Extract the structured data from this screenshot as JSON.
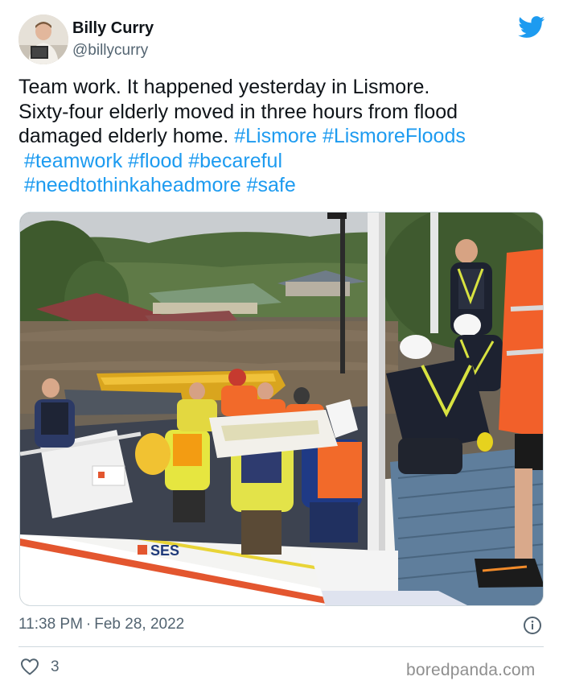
{
  "author": {
    "display_name": "Billy Curry",
    "handle": "@billycurry"
  },
  "tweet": {
    "lines": [
      [
        {
          "text": "Team work. It happened yesterday in Lismore.",
          "tag": false
        }
      ],
      [
        {
          "text": "Sixty-four elderly moved in three hours from flood",
          "tag": false
        }
      ],
      [
        {
          "text": "damaged elderly home. ",
          "tag": false
        },
        {
          "text": "#Lismore",
          "tag": true
        },
        {
          "text": " ",
          "tag": false
        },
        {
          "text": "#LismoreFloods",
          "tag": true
        }
      ],
      [
        {
          "text": " ",
          "tag": false
        },
        {
          "text": "#teamwork",
          "tag": true
        },
        {
          "text": " ",
          "tag": false
        },
        {
          "text": "#flood",
          "tag": true
        },
        {
          "text": " ",
          "tag": false
        },
        {
          "text": "#becareful",
          "tag": true
        }
      ],
      [
        {
          "text": " ",
          "tag": false
        },
        {
          "text": "#needtothinkaheadmore",
          "tag": true
        },
        {
          "text": " ",
          "tag": false
        },
        {
          "text": "#safe",
          "tag": true
        }
      ]
    ]
  },
  "photo": {
    "boat_label": "SES"
  },
  "meta": {
    "time": "11:38 PM",
    "separator": "·",
    "date": "Feb 28, 2022",
    "likes": "3"
  },
  "watermark": "boredpanda.com",
  "icons": {
    "brand": "twitter-bird-icon",
    "info": "info-icon",
    "like": "heart-icon"
  },
  "colors": {
    "link": "#1d9bf0",
    "secondary_text": "#536471",
    "primary_text": "#0f1419",
    "brand": "#1d9bf0"
  }
}
